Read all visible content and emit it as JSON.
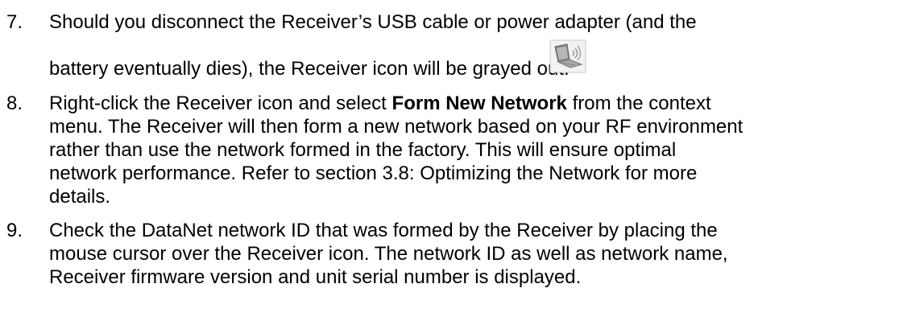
{
  "doc": {
    "items": [
      {
        "number": "7.",
        "line1": "Should you disconnect the Receiver’s USB cable or power adapter (and the",
        "line2": "battery eventually dies), the Receiver icon will be grayed out:",
        "icon": "receiver-laptop-wireless-icon-grayed"
      },
      {
        "number": "8.",
        "line1_pre": "Right-click the Receiver icon and select ",
        "line1_bold": "Form New Network",
        "line1_post": " from the context",
        "line2": "menu. The Receiver will then form a new network based on your RF environment",
        "line3": "rather than use the network formed in the factory. This will ensure optimal",
        "line4": "network performance. Refer to section 3.8: Optimizing the Network for more",
        "line5": "details."
      },
      {
        "number": "9.",
        "line1": "Check the DataNet network ID that was formed by the Receiver by placing the",
        "line2": "mouse cursor over the Receiver icon. The network ID as well as network name,",
        "line3": "Receiver firmware version and unit serial number is displayed."
      }
    ]
  }
}
